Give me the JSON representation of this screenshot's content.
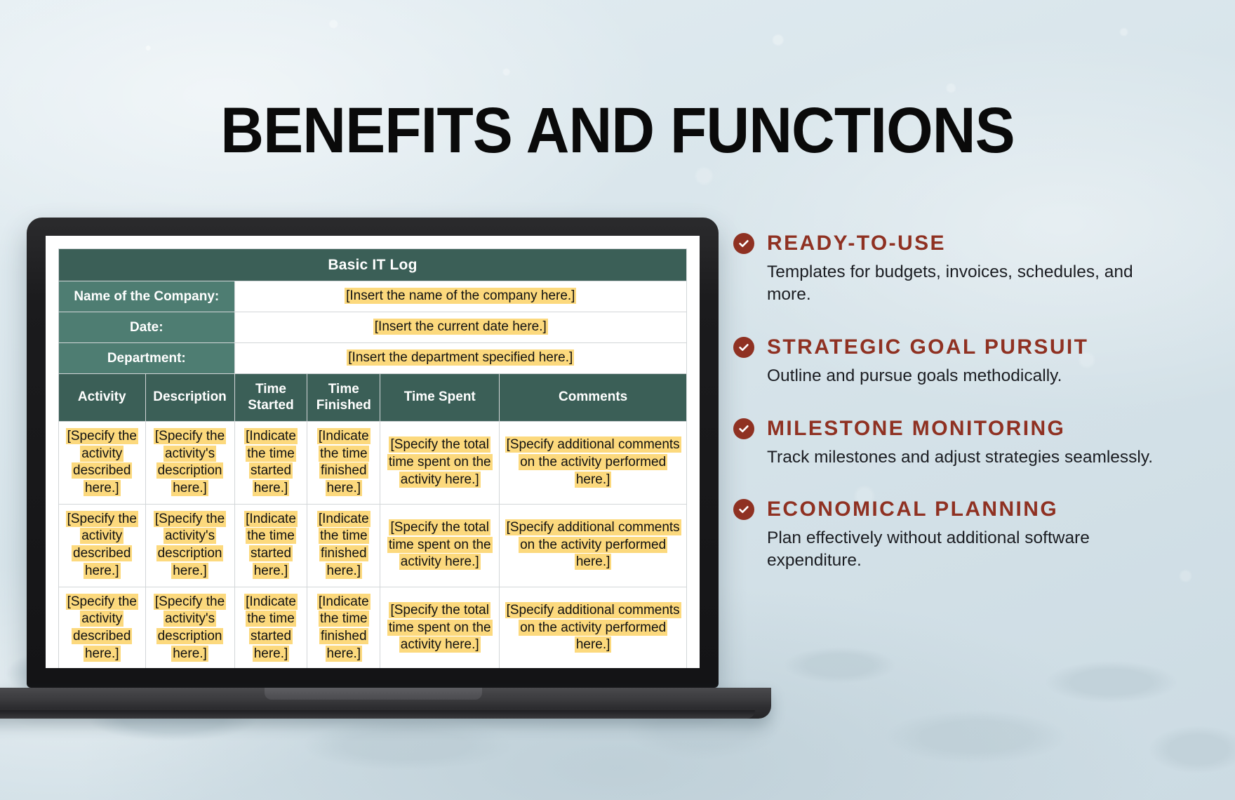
{
  "page": {
    "headline": "BENEFITS AND FUNCTIONS",
    "background_color": "#dbe6ec",
    "accent_color": "#8f3122",
    "table_header_color": "#3b5f57",
    "table_label_color": "#4e7d72",
    "highlight_color": "#fcd97d"
  },
  "spreadsheet": {
    "title": "Basic IT Log",
    "info_rows": [
      {
        "label": "Name of the Company:",
        "value": "[Insert the name of the company here.]"
      },
      {
        "label": "Date:",
        "value": "[Insert the current date here.]"
      },
      {
        "label": "Department:",
        "value": "[Insert the department specified here.]"
      }
    ],
    "columns": [
      "Activity",
      "Description",
      "Time Started",
      "Time Finished",
      "Time Spent",
      "Comments"
    ],
    "rows": [
      {
        "activity": "[Specify the activity described here.]",
        "description": "[Specify the activity's description here.]",
        "time_started": "[Indicate the time started here.]",
        "time_finished": "[Indicate the time finished here.]",
        "time_spent": "[Specify the total time spent on the activity here.]",
        "comments": "[Specify additional comments on the activity performed here.]"
      },
      {
        "activity": "[Specify the activity described here.]",
        "description": "[Specify the activity's description here.]",
        "time_started": "[Indicate the time started here.]",
        "time_finished": "[Indicate the time finished here.]",
        "time_spent": "[Specify the total time spent on the activity here.]",
        "comments": "[Specify additional comments on the activity performed here.]"
      },
      {
        "activity": "[Specify the activity described here.]",
        "description": "[Specify the activity's description here.]",
        "time_started": "[Indicate the time started here.]",
        "time_finished": "[Indicate the time finished here.]",
        "time_spent": "[Specify the total time spent on the activity here.]",
        "comments": "[Specify additional comments on the activity performed here.]"
      }
    ]
  },
  "benefits": {
    "icon": "check-circle-icon",
    "items": [
      {
        "title": "READY-TO-USE",
        "body": "Templates for budgets, invoices, schedules, and more."
      },
      {
        "title": "STRATEGIC GOAL PURSUIT",
        "body": "Outline and pursue goals methodically."
      },
      {
        "title": "MILESTONE MONITORING",
        "body": "Track milestones and adjust strategies seamlessly."
      },
      {
        "title": "ECONOMICAL PLANNING",
        "body": "Plan effectively without additional software expenditure."
      }
    ]
  }
}
